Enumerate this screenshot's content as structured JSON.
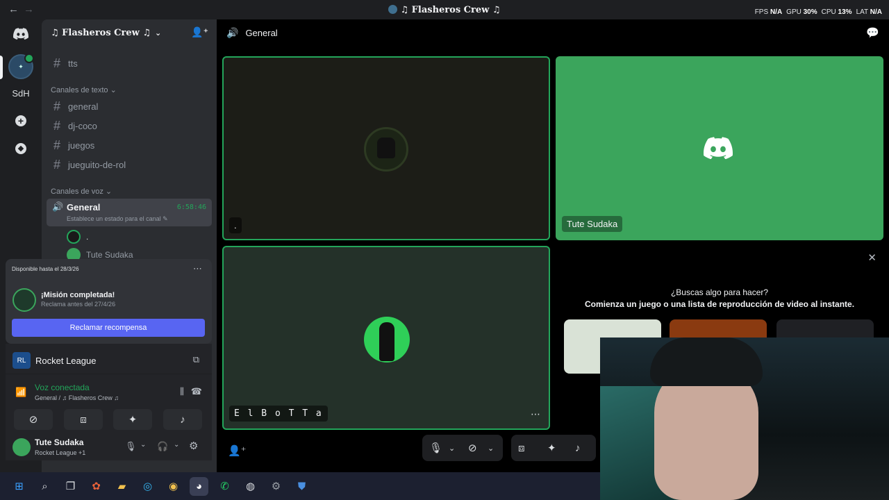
{
  "titlebar": {
    "title": "♫ Flasheros Crew ♫",
    "back": "←",
    "forward": "→",
    "overlay": {
      "fps_label": "FPS",
      "fps_value": "N/A",
      "gpu_label": "GPU",
      "gpu_value": "30%",
      "cpu_label": "CPU",
      "cpu_value": "13%",
      "lat_label": "LAT",
      "lat_value": "N/A"
    }
  },
  "rail": {
    "server_short": "SdH"
  },
  "sidebar": {
    "server_name": "♫ Flasheros Crew ♫",
    "top_channel": "tts",
    "text_category": "Canales de texto",
    "text_channels": [
      "general",
      "dj-coco",
      "juegos",
      "jueguito-de-rol"
    ],
    "voice_category": "Canales de voz",
    "voice_channel": {
      "name": "General",
      "timer": "6:58:46",
      "status_placeholder": "Establece un estado para el canal"
    },
    "voice_members": [
      ".",
      "Tute Sudaka"
    ]
  },
  "quest": {
    "available_until": "Disponible hasta el 28/3/26",
    "title": "¡Misión completada!",
    "subtitle": "Reclama antes del 27/4/26",
    "button": "Reclamar recompensa"
  },
  "activity": {
    "game": "Rocket League"
  },
  "voice_panel": {
    "status": "Voz conectada",
    "location": "General / ♫ Flasheros Crew ♫"
  },
  "user": {
    "name": "Tute Sudaka",
    "activity": "Rocket League +1"
  },
  "main": {
    "channel_name": "General",
    "tiles": [
      {
        "name": "."
      },
      {
        "name": "Tute Sudaka"
      },
      {
        "name": "E l  B o T T a"
      }
    ],
    "activity_prompt_title": "¿Buscas algo para hacer?",
    "activity_prompt_subtitle": "Comienza un juego o una lista de reproducción de video al instante."
  },
  "colors": {
    "blurple": "#5865f2",
    "green": "#3ba55c",
    "connected_green": "#23a55a"
  },
  "icons": {
    "speaker": "speaker-icon",
    "close": "close-icon"
  }
}
